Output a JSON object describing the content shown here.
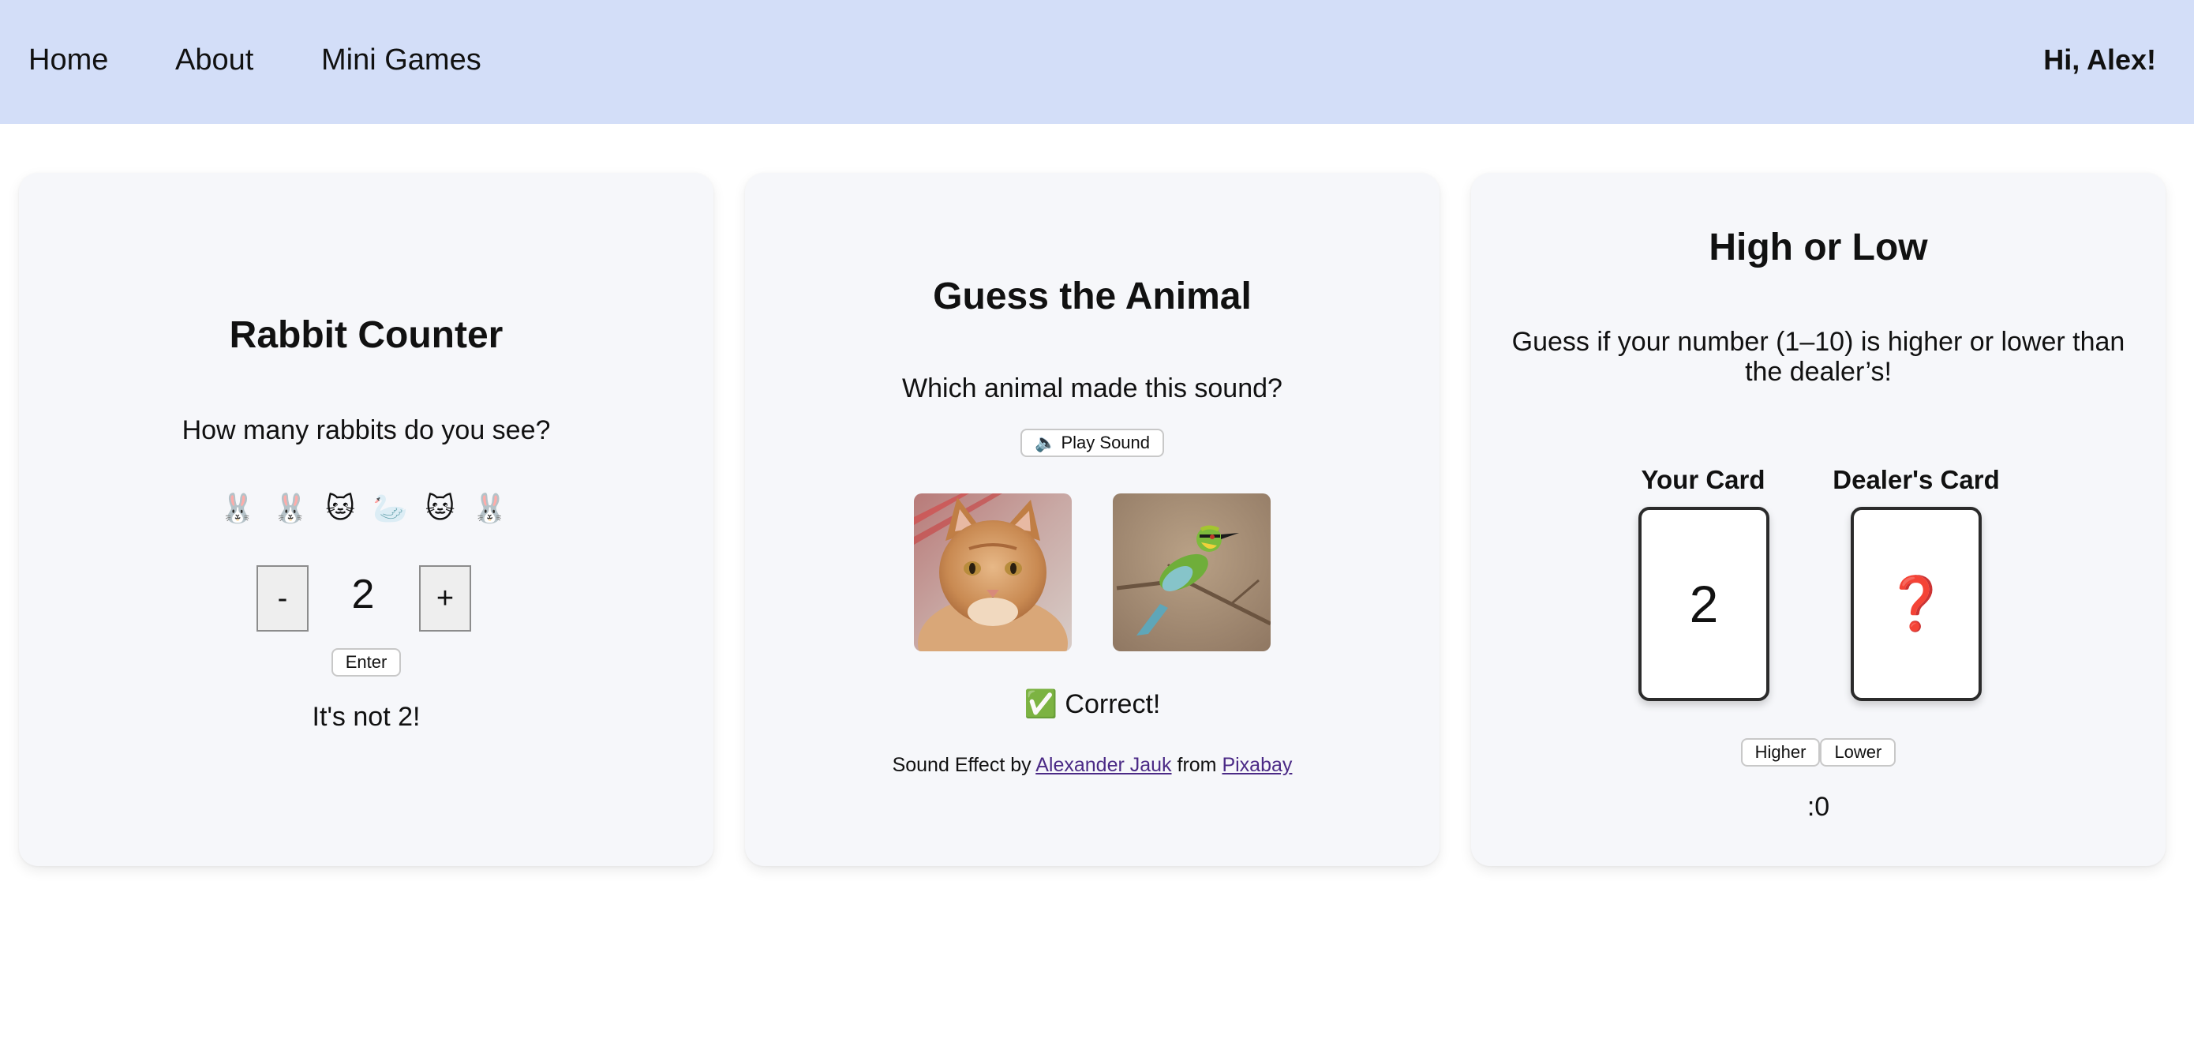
{
  "nav": {
    "home": "Home",
    "about": "About",
    "mini_games": "Mini Games",
    "greeting": "Hi, Alex!"
  },
  "rabbit_counter": {
    "title": "Rabbit Counter",
    "prompt": "How many rabbits do you see?",
    "animals": [
      "🐰",
      "🐰",
      "🐱",
      "🦢",
      "🐱",
      "🐰"
    ],
    "minus_label": "-",
    "plus_label": "+",
    "count": "2",
    "enter_label": "Enter",
    "result": "It's not 2!"
  },
  "guess_animal": {
    "title": "Guess the Animal",
    "prompt": "Which animal made this sound?",
    "play_icon": "speaker-icon",
    "play_label": "🔈 Play Sound",
    "choices": [
      "cat",
      "bird"
    ],
    "result": "✅ Correct!",
    "credit": {
      "prefix": "Sound Effect by",
      "author": "Alexander Jauk",
      "middle": "from",
      "source": "Pixabay"
    }
  },
  "high_low": {
    "title": "High or Low",
    "prompt": "Guess if your number (1–10) is higher or lower than the dealer’s!",
    "your_card_label": "Your Card",
    "dealer_card_label": "Dealer's Card",
    "your_card_value": "2",
    "dealer_card_value": "❓",
    "higher_label": "Higher",
    "lower_label": "Lower",
    "score": ":0"
  },
  "colors": {
    "navbar": "#d3def8",
    "card_background": "#f6f7fa",
    "link": "#4b2a86",
    "question_mark": "#d0281e"
  }
}
